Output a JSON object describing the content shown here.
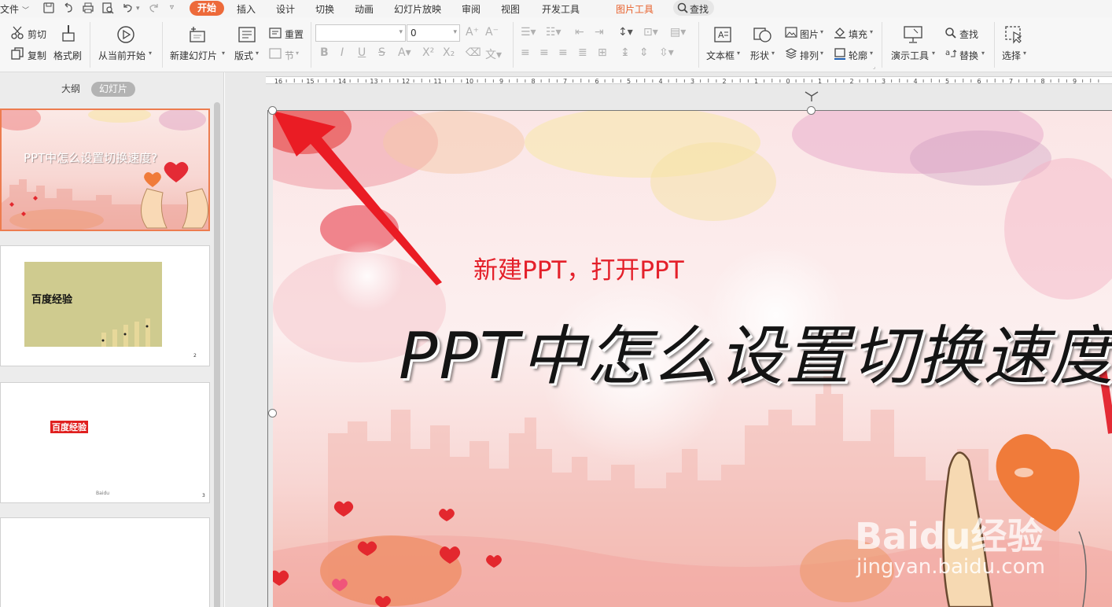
{
  "menu": {
    "file": "文件",
    "tabs": [
      {
        "label": "开始",
        "active": true
      },
      {
        "label": "插入"
      },
      {
        "label": "设计"
      },
      {
        "label": "切换"
      },
      {
        "label": "动画"
      },
      {
        "label": "幻灯片放映"
      },
      {
        "label": "审阅"
      },
      {
        "label": "视图"
      },
      {
        "label": "开发工具"
      },
      {
        "label": "图片工具",
        "contextual": true
      }
    ],
    "search": "查找"
  },
  "ribbon": {
    "cut": "剪切",
    "copy": "复制",
    "format_painter": "格式刷",
    "from_current": "从当前开始",
    "new_slide": "新建幻灯片",
    "layout": "版式",
    "reset": "重置",
    "section": "节",
    "font_name": "",
    "font_size": "0",
    "textbox": "文本框",
    "shape": "形状",
    "picture": "图片",
    "arrange": "排列",
    "fill": "填充",
    "outline": "轮廓",
    "present_tools": "演示工具",
    "find": "查找",
    "replace": "替换",
    "select": "选择"
  },
  "left_panel": {
    "outline_tab": "大纲",
    "slides_tab": "幻灯片",
    "thumb1_title": "PPT中怎么设置切换速度?",
    "thumb2_text": "百度经验",
    "thumb2_num": "2",
    "thumb3_text": "百度经验",
    "thumb3_small": "Baidu",
    "thumb3_num": "3"
  },
  "ruler": {
    "labels": [
      "16",
      "15",
      "14",
      "13",
      "12",
      "11",
      "10",
      "9",
      "8",
      "7",
      "6",
      "5",
      "4",
      "3",
      "2",
      "1",
      "0",
      "1",
      "2",
      "3",
      "4",
      "5",
      "6",
      "7",
      "8",
      "9"
    ]
  },
  "slide": {
    "annotation": "新建PPT，打开PPT",
    "title": "PPT中怎么设置切换速度",
    "watermark_logo": "Baidu经验",
    "watermark_url": "jingyan.baidu.com"
  },
  "colors": {
    "accent_orange": "#ed6a3a",
    "annotation_red": "#e4202a",
    "thumb2_bg": "#cfcb8f"
  }
}
